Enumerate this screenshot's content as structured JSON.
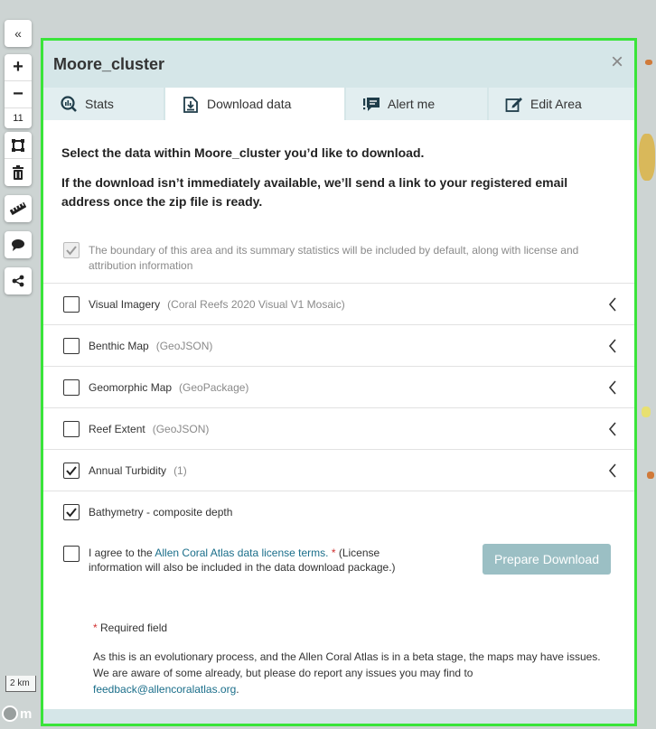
{
  "map": {
    "zoom_level": "11",
    "scale_label": "2 km",
    "logo_text": "m"
  },
  "toolbar": {
    "collapse_glyph": "«",
    "zoom_in_glyph": "+",
    "zoom_out_glyph": "−"
  },
  "panel": {
    "title": "Moore_cluster",
    "close_glyph": "×",
    "tabs": [
      {
        "label": "Stats",
        "icon": "stats-icon"
      },
      {
        "label": "Download data",
        "icon": "download-icon"
      },
      {
        "label": "Alert me",
        "icon": "alert-icon"
      },
      {
        "label": "Edit Area",
        "icon": "edit-icon"
      }
    ],
    "active_tab": "Download data",
    "intro_line1": "Select the data within Moore_cluster you’d like to download.",
    "intro_line2": "If the download isn’t immediately available, we’ll send a link to your registered email address once the zip file is ready.",
    "default_notice": "The boundary of this area and its summary statistics will be included by default, along with license and attribution information",
    "datasets": [
      {
        "label": "Visual Imagery",
        "detail": "(Coral Reefs 2020 Visual V1 Mosaic)",
        "checked": false,
        "expandable": true
      },
      {
        "label": "Benthic Map",
        "detail": "(GeoJSON)",
        "checked": false,
        "expandable": true
      },
      {
        "label": "Geomorphic Map",
        "detail": "(GeoPackage)",
        "checked": false,
        "expandable": true
      },
      {
        "label": "Reef Extent",
        "detail": "(GeoJSON)",
        "checked": false,
        "expandable": true
      },
      {
        "label": "Annual Turbidity",
        "detail": "(1)",
        "checked": true,
        "expandable": true
      },
      {
        "label": "Bathymetry - composite depth",
        "detail": "",
        "checked": true,
        "expandable": false
      }
    ],
    "agree_prefix": "I agree to the ",
    "agree_link": "Allen Coral Atlas data license terms.",
    "agree_star": " *",
    "agree_suffix": " (License information will also be included in the data download package.)",
    "prepare_button": "Prepare Download",
    "required_star": "*",
    "required_label": " Required field",
    "beta_note": "As this is an evolutionary process, and the Allen Coral Atlas is in a beta stage, the maps may have issues. We are aware of some already, but please do report any issues you may find to ",
    "feedback_email": "feedback@allencoralatlas.org",
    "beta_note_end": "."
  },
  "colors": {
    "panel_border": "#3ae43a",
    "header_bg": "#d5e6e8",
    "button_bg": "#9bbfc4",
    "link": "#1a6e8a"
  }
}
